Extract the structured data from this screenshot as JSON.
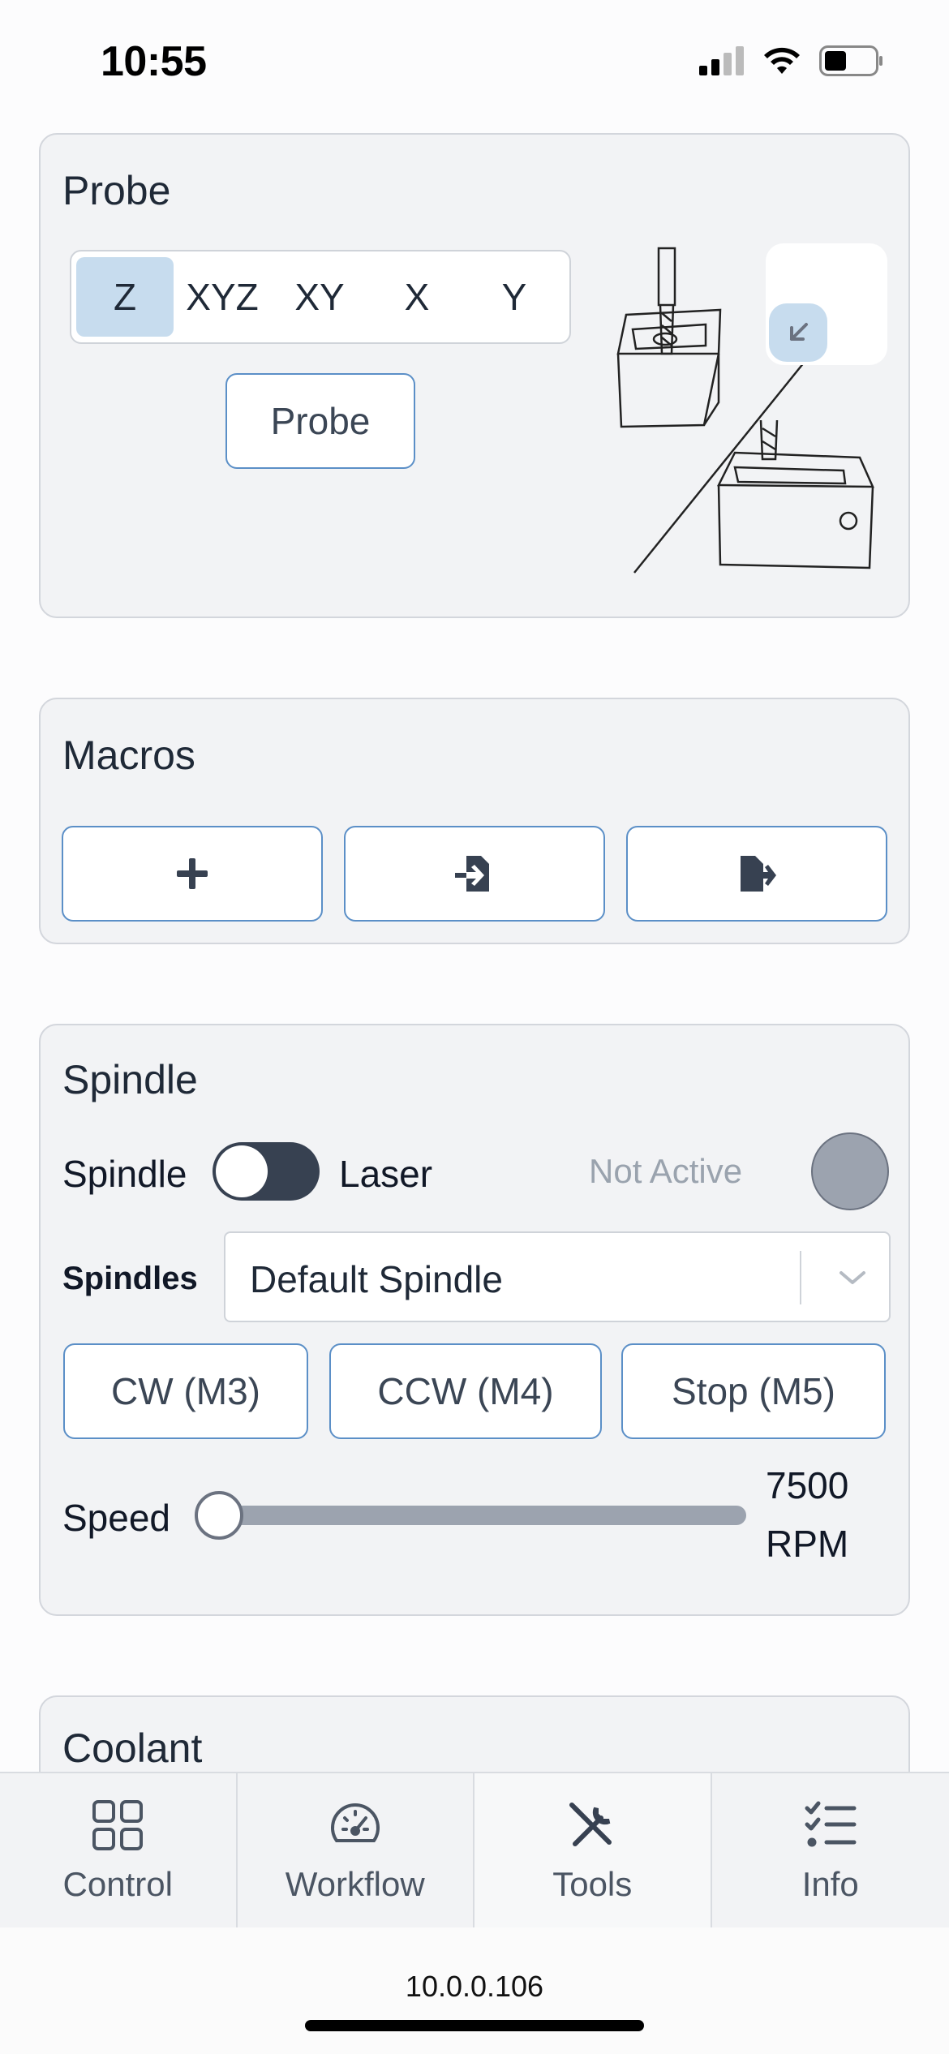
{
  "status_bar": {
    "time": "10:55"
  },
  "probe": {
    "title": "Probe",
    "axes": [
      "Z",
      "XYZ",
      "XY",
      "X",
      "Y"
    ],
    "selected_axis": "Z",
    "button_label": "Probe"
  },
  "macros": {
    "title": "Macros",
    "buttons": [
      {
        "icon": "plus-icon"
      },
      {
        "icon": "file-import-icon"
      },
      {
        "icon": "file-export-icon"
      }
    ]
  },
  "spindle": {
    "title": "Spindle",
    "toggle_left_label": "Spindle",
    "toggle_right_label": "Laser",
    "status_text": "Not Active",
    "spindles_label": "Spindles",
    "selected_spindle": "Default Spindle",
    "buttons": [
      "CW (M3)",
      "CCW (M4)",
      "Stop (M5)"
    ],
    "speed_label": "Speed",
    "speed_value": "7500",
    "speed_unit": "RPM"
  },
  "coolant": {
    "title": "Coolant"
  },
  "nav": {
    "items": [
      {
        "label": "Control",
        "icon": "grid-icon"
      },
      {
        "label": "Workflow",
        "icon": "gauge-icon"
      },
      {
        "label": "Tools",
        "icon": "tools-icon"
      },
      {
        "label": "Info",
        "icon": "checklist-icon"
      }
    ],
    "active": "Tools"
  },
  "address_bar": {
    "url": "10.0.0.106"
  },
  "colors": {
    "accent_border": "#5b8fc7",
    "selected_bg": "#c7dcee",
    "toggle_bg": "#374151"
  }
}
